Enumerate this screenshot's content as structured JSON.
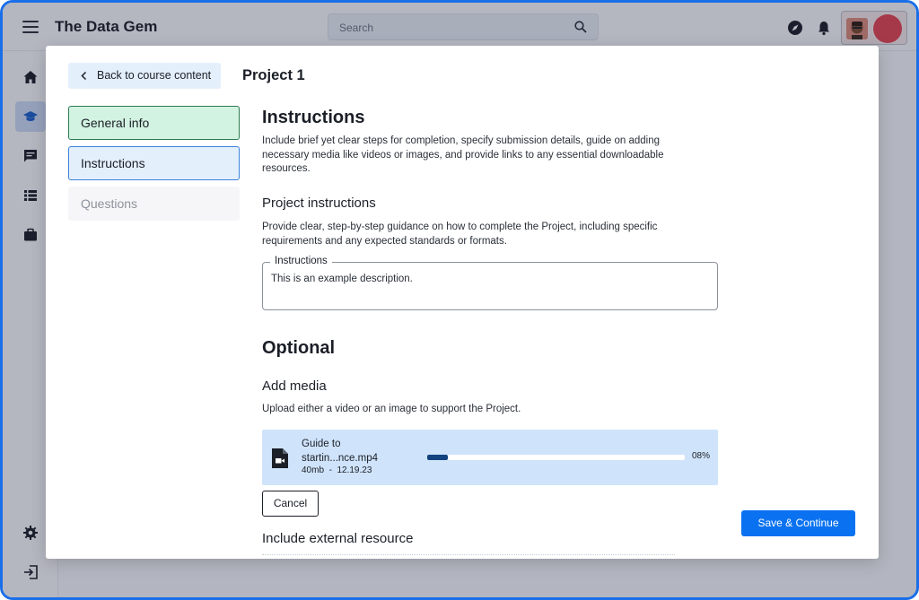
{
  "header": {
    "app_title": "The Data Gem",
    "search_placeholder": "Search"
  },
  "modal": {
    "back_label": "Back to course content",
    "title": "Project 1",
    "nav": [
      {
        "label": "General info",
        "state": "completed"
      },
      {
        "label": "Instructions",
        "state": "active"
      },
      {
        "label": "Questions",
        "state": "disabled"
      }
    ],
    "instructions": {
      "heading": "Instructions",
      "description": "Include brief yet clear steps for completion, specify submission details, guide on adding necessary media like videos or images, and provide links to any essential downloadable resources."
    },
    "project_instructions": {
      "heading": "Project instructions",
      "description": "Provide clear, step-by-step guidance on how to complete the Project, including specific requirements and any expected standards or formats.",
      "field_label": "Instructions",
      "field_value": "This is an example description."
    },
    "optional": {
      "heading": "Optional",
      "add_media_heading": "Add media",
      "add_media_description": "Upload either a video or an image to support the Project.",
      "upload": {
        "file_name": "Guide to startin...nce.mp4",
        "size": "40mb",
        "date": "12.19.23",
        "progress_label": "08%",
        "progress": 0.08
      },
      "cancel_label": "Cancel",
      "external_heading": "Include external resource"
    },
    "save_label": "Save & Continue"
  },
  "colors": {
    "accent": "#0a72f0",
    "completed_bg": "#d3f3e2",
    "active_bg": "#e4effc",
    "frame": "#1a6fe8"
  },
  "icons": {
    "topbar": [
      "menu-icon",
      "search-icon",
      "compass-icon",
      "bell-icon"
    ],
    "sidebar": [
      "home-icon",
      "graduation-cap-icon",
      "chat-icon",
      "list-icon",
      "briefcase-icon",
      "gear-icon",
      "logout-icon"
    ],
    "upload": "video-file-icon"
  }
}
